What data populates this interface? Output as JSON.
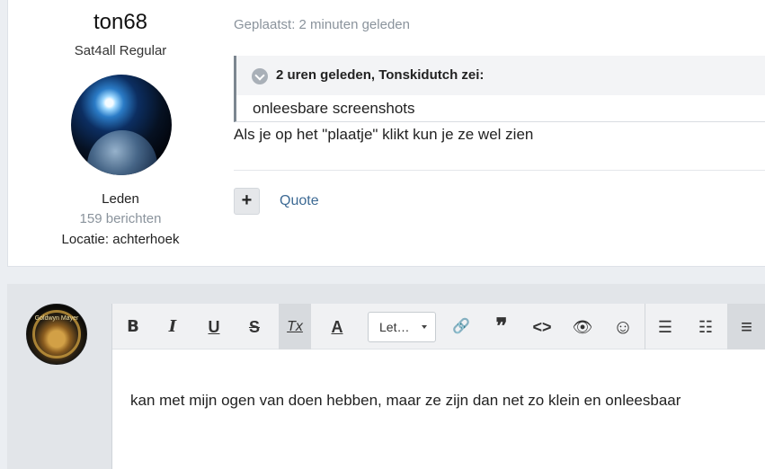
{
  "post": {
    "author_name": "ton68",
    "author_rank": "Sat4all Regular",
    "author_group": "Leden",
    "author_posts": "159 berichten",
    "author_location": "Locatie: achterhoek",
    "posted": "Geplaatst: 2 minuten geleden",
    "quote_cite": "2 uren geleden, Tonskidutch zei:",
    "quote_body": "onleesbare screenshots",
    "text": "Als je op het \"plaatje\" klikt kun je ze wel zien",
    "plus_label": "+",
    "quote_link": "Quote"
  },
  "reply": {
    "avatar_caption": "Goldwyn Mayer",
    "toolbar": {
      "bold": "B",
      "italic": "I",
      "underline": "U",
      "strike": "S",
      "clear_format": "Tx",
      "text_color": "A",
      "font_select": "Let…",
      "link": "🔗",
      "quote": "❞",
      "code": "<>",
      "preview": "👁",
      "emoji": "☺",
      "bullet_list": "☰",
      "numbered_list": "☷",
      "align_left": "≡"
    },
    "editor_text": "kan met mijn ogen van doen hebben, maar ze zijn dan net zo klein en onleesbaar"
  },
  "colors": {
    "link": "#3d6a94",
    "muted": "#8a939c",
    "quote_border": "#7c8690"
  }
}
